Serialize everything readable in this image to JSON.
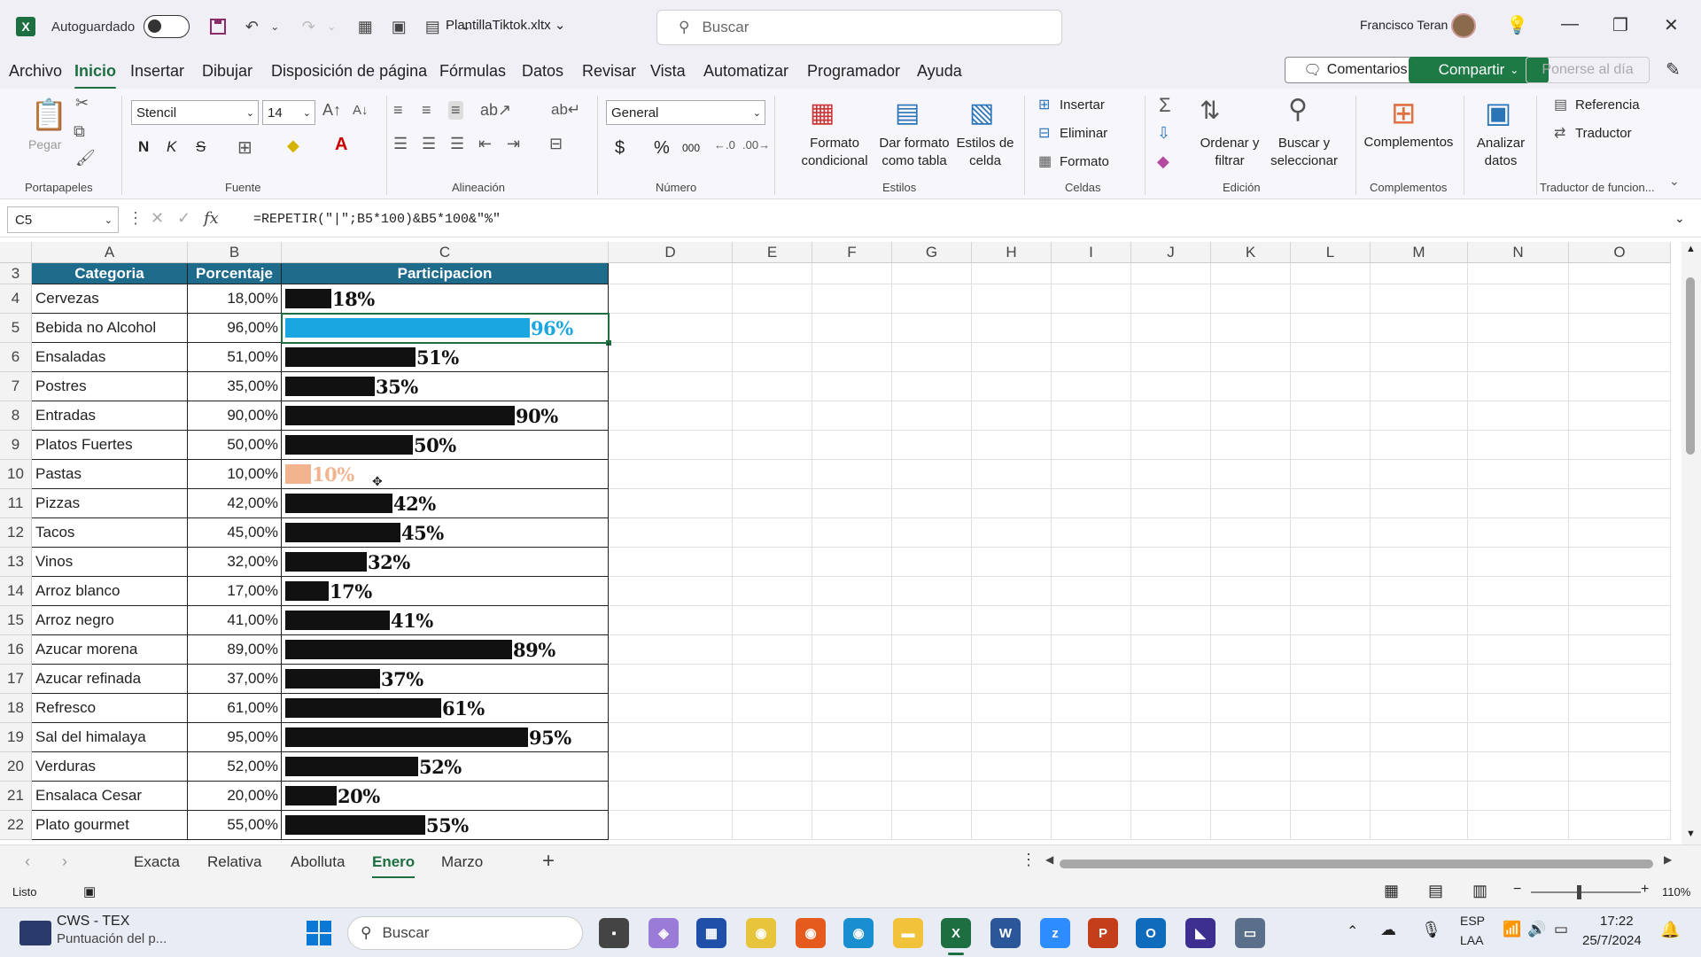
{
  "window": {
    "autosave_label": "Autoguardado",
    "doc_title": "PlantillaTiktok.xltx ⌄",
    "search_placeholder": "Buscar",
    "user_name": "Francisco Teran"
  },
  "menu": {
    "items": [
      "Archivo",
      "Inicio",
      "Insertar",
      "Dibujar",
      "Disposición de página",
      "Fórmulas",
      "Datos",
      "Revisar",
      "Vista",
      "Automatizar",
      "Programador",
      "Ayuda"
    ],
    "active": "Inicio",
    "comments_label": "Comentarios",
    "share_label": "Compartir",
    "update_label": "Ponerse al día"
  },
  "ribbon": {
    "paste_label": "Pegar",
    "clipboard_group": "Portapapeles",
    "font_name": "Stencil",
    "font_size": "14",
    "font_group": "Fuente",
    "bold": "N",
    "italic": "K",
    "strike": "S",
    "alignment_group": "Alineación",
    "number_format": "General",
    "number_group": "Número",
    "currency": "$",
    "percent": "%",
    "thousands": "000",
    "cond_format": "Formato condicional",
    "format_table": "Dar formato como tabla",
    "cell_styles": "Estilos de celda",
    "styles_group": "Estilos",
    "insert": "Insertar",
    "delete": "Eliminar",
    "format": "Formato",
    "cells_group": "Celdas",
    "sort_filter": "Ordenar y filtrar",
    "find_select": "Buscar y seleccionar",
    "edit_group": "Edición",
    "addins": "Complementos",
    "addins_group": "Complementos",
    "analyze": "Analizar datos",
    "reference": "Referencia",
    "translator": "Traductor",
    "translator_group": "Traductor de funcion..."
  },
  "formula_bar": {
    "name_box": "C5",
    "fx": "fx",
    "formula": "=REPETIR(\"|\";B5*100)&B5*100&\"%\""
  },
  "columns": [
    "A",
    "B",
    "C",
    "D",
    "E",
    "F",
    "G",
    "H",
    "I",
    "J",
    "K",
    "L",
    "M",
    "N",
    "O"
  ],
  "table_headers": {
    "a": "Categoria",
    "b": "Porcentaje",
    "c": "Participacion"
  },
  "rows": [
    {
      "row": "3"
    },
    {
      "row": "4",
      "categoria": "Cervezas",
      "porcentaje": "18,00%",
      "value": 18,
      "label": "18%"
    },
    {
      "row": "5",
      "categoria": "Bebida no Alcohol",
      "porcentaje": "96,00%",
      "value": 96,
      "label": "96%",
      "color": "#1aa6e0"
    },
    {
      "row": "6",
      "categoria": "Ensaladas",
      "porcentaje": "51,00%",
      "value": 51,
      "label": "51%"
    },
    {
      "row": "7",
      "categoria": "Postres",
      "porcentaje": "35,00%",
      "value": 35,
      "label": "35%"
    },
    {
      "row": "8",
      "categoria": "Entradas",
      "porcentaje": "90,00%",
      "value": 90,
      "label": "90%"
    },
    {
      "row": "9",
      "categoria": "Platos Fuertes",
      "porcentaje": "50,00%",
      "value": 50,
      "label": "50%"
    },
    {
      "row": "10",
      "categoria": "Pastas",
      "porcentaje": "10,00%",
      "value": 10,
      "label": "10%",
      "color": "#f2b48f"
    },
    {
      "row": "11",
      "categoria": "Pizzas",
      "porcentaje": "42,00%",
      "value": 42,
      "label": "42%"
    },
    {
      "row": "12",
      "categoria": "Tacos",
      "porcentaje": "45,00%",
      "value": 45,
      "label": "45%"
    },
    {
      "row": "13",
      "categoria": "Vinos",
      "porcentaje": "32,00%",
      "value": 32,
      "label": "32%"
    },
    {
      "row": "14",
      "categoria": "Arroz blanco",
      "porcentaje": "17,00%",
      "value": 17,
      "label": "17%"
    },
    {
      "row": "15",
      "categoria": "Arroz negro",
      "porcentaje": "41,00%",
      "value": 41,
      "label": "41%"
    },
    {
      "row": "16",
      "categoria": "Azucar morena",
      "porcentaje": "89,00%",
      "value": 89,
      "label": "89%"
    },
    {
      "row": "17",
      "categoria": "Azucar refinada",
      "porcentaje": "37,00%",
      "value": 37,
      "label": "37%"
    },
    {
      "row": "18",
      "categoria": "Refresco",
      "porcentaje": "61,00%",
      "value": 61,
      "label": "61%"
    },
    {
      "row": "19",
      "categoria": "Sal del himalaya",
      "porcentaje": "95,00%",
      "value": 95,
      "label": "95%"
    },
    {
      "row": "20",
      "categoria": "Verduras",
      "porcentaje": "52,00%",
      "value": 52,
      "label": "52%"
    },
    {
      "row": "21",
      "categoria": "Ensalaca Cesar",
      "porcentaje": "20,00%",
      "value": 20,
      "label": "20%"
    },
    {
      "row": "22",
      "categoria": "Plato gourmet",
      "porcentaje": "55,00%",
      "value": 55,
      "label": "55%"
    }
  ],
  "sheet_tabs": [
    "Exacta",
    "Relativa",
    "Abolluta",
    "Enero",
    "Marzo"
  ],
  "active_sheet": "Enero",
  "status": {
    "ready": "Listo",
    "zoom": "110%"
  },
  "taskbar": {
    "weather_title": "CWS - TEX",
    "weather_sub": "Puntuación del p...",
    "search": "Buscar",
    "lang": "ESP",
    "lang_sub": "LAA",
    "time": "17:22",
    "date": "25/7/2024"
  },
  "colors": {
    "excel_green": "#1d6f42",
    "header_fill": "#1f6b8c",
    "bar_black": "#111111"
  }
}
